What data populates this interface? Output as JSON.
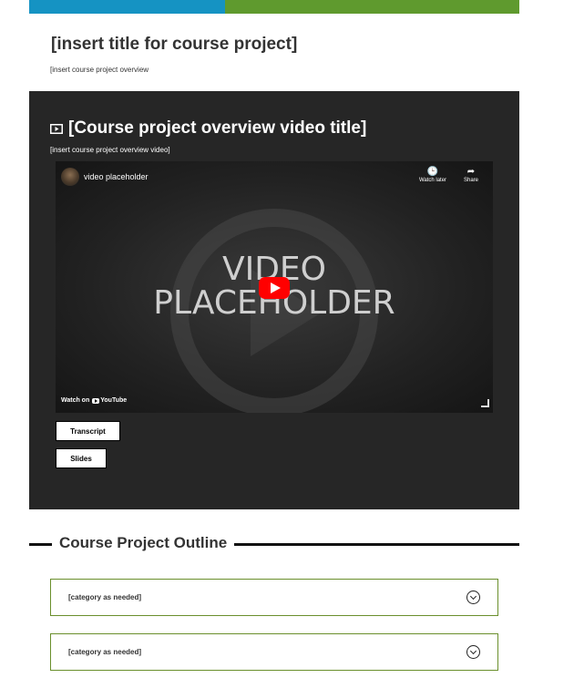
{
  "page": {
    "title": "[insert title for course project]",
    "overview": "[insert course project overview"
  },
  "video_section": {
    "icon": "video-play-icon",
    "title": "[Course project overview video title]",
    "subtitle": "[insert course project overview video]",
    "player": {
      "channel_name": "video placeholder",
      "placeholder_line1": "VIDEO",
      "placeholder_line2": "PLACEHOLDER",
      "watch_later_label": "Watch later",
      "share_label": "Share",
      "watch_on_label": "Watch on",
      "youtube_label": "YouTube",
      "play_button_color": "#ff0000"
    },
    "buttons": {
      "transcript_label": "Transcript",
      "slides_label": "Slides"
    }
  },
  "outline": {
    "title": "Course Project Outline",
    "accordions": [
      {
        "label": "[category as needed]",
        "icon": "chevron-down-circle-icon"
      },
      {
        "label": "[category as needed]",
        "icon": "chevron-down-circle-icon"
      }
    ]
  },
  "colors": {
    "brand_blue": "#1593c3",
    "brand_green": "#5f9a2e",
    "video_bg": "#262626",
    "accordion_border": "#6a8f2c"
  }
}
